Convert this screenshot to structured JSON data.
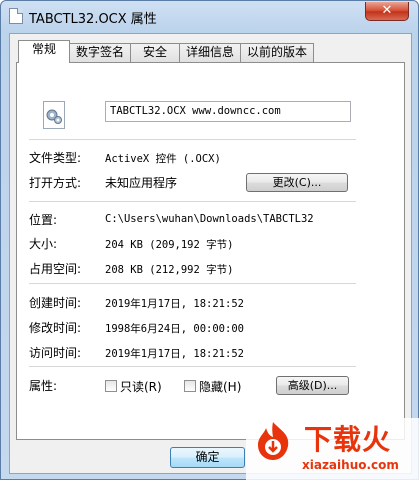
{
  "window": {
    "title": "TABCTL32.OCX 属性",
    "close_glyph": "✕"
  },
  "tabs": [
    {
      "label": "常规",
      "active": true
    },
    {
      "label": "数字签名",
      "active": false
    },
    {
      "label": "安全",
      "active": false
    },
    {
      "label": "详细信息",
      "active": false
    },
    {
      "label": "以前的版本",
      "active": false
    }
  ],
  "general": {
    "file_icon": "activex-file-icon",
    "file_name": "TABCTL32.OCX  www.downcc.com",
    "type_label": "文件类型:",
    "type_value": "ActiveX 控件 (.OCX)",
    "opens_with_label": "打开方式:",
    "opens_with_value": "未知应用程序",
    "change_button": "更改(C)...",
    "location_label": "位置:",
    "location_value": "C:\\Users\\wuhan\\Downloads\\TABCTL32",
    "size_label": "大小:",
    "size_value": "204 KB (209,192 字节)",
    "size_on_disk_label": "占用空间:",
    "size_on_disk_value": "208 KB (212,992 字节)",
    "created_label": "创建时间:",
    "created_value": "2019年1月17日, 18:21:52",
    "modified_label": "修改时间:",
    "modified_value": "1998年6月24日, 00:00:00",
    "accessed_label": "访问时间:",
    "accessed_value": "2019年1月17日, 18:21:52",
    "attributes_label": "属性:",
    "readonly_label": "只读(R)",
    "readonly_checked": false,
    "hidden_label": "隐藏(H)",
    "hidden_checked": false,
    "advanced_button": "高级(D)..."
  },
  "footer": {
    "ok_button": "确定"
  },
  "watermark": {
    "brand": "下载火",
    "url": "xiazaihuo.com",
    "color": "#e8340c"
  }
}
